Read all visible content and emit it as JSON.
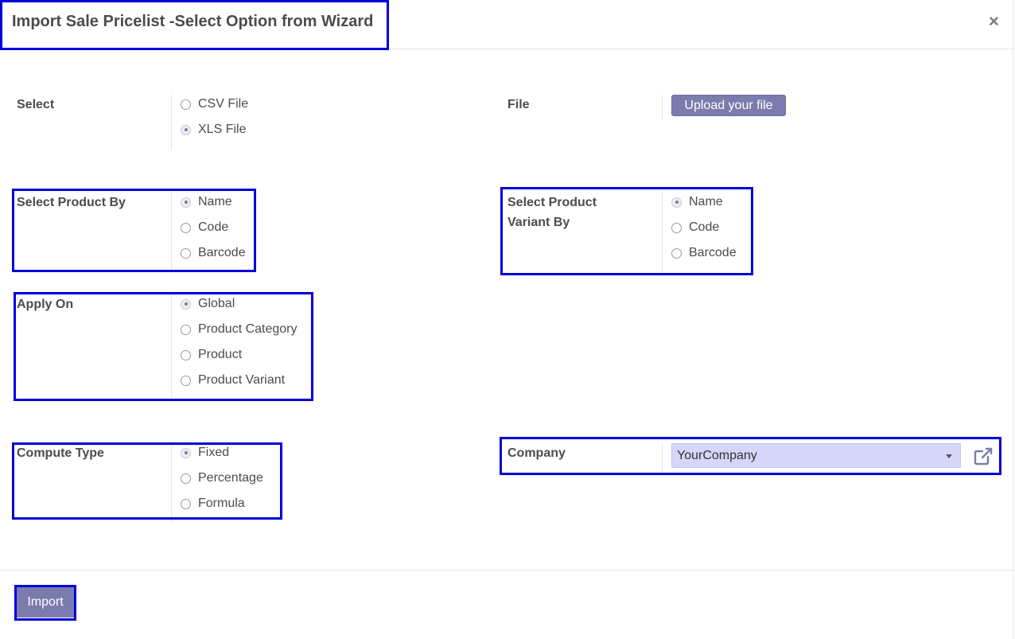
{
  "dialog": {
    "title": "Import Sale Pricelist -Select Option from Wizard",
    "close_label": "×"
  },
  "select": {
    "label": "Select",
    "options": [
      {
        "label": "CSV File",
        "checked": false
      },
      {
        "label": "XLS File",
        "checked": true
      }
    ]
  },
  "file": {
    "label": "File",
    "upload_label": "Upload your file"
  },
  "product_by": {
    "label": "Select Product By",
    "options": [
      {
        "label": "Name",
        "checked": true
      },
      {
        "label": "Code",
        "checked": false
      },
      {
        "label": "Barcode",
        "checked": false
      }
    ]
  },
  "variant_by": {
    "label_line1": "Select Product",
    "label_line2": "Variant By",
    "options": [
      {
        "label": "Name",
        "checked": true
      },
      {
        "label": "Code",
        "checked": false
      },
      {
        "label": "Barcode",
        "checked": false
      }
    ]
  },
  "apply_on": {
    "label": "Apply On",
    "options": [
      {
        "label": "Global",
        "checked": true
      },
      {
        "label": "Product Category",
        "checked": false
      },
      {
        "label": "Product",
        "checked": false
      },
      {
        "label": "Product Variant",
        "checked": false
      }
    ]
  },
  "compute_type": {
    "label": "Compute Type",
    "options": [
      {
        "label": "Fixed",
        "checked": true
      },
      {
        "label": "Percentage",
        "checked": false
      },
      {
        "label": "Formula",
        "checked": false
      }
    ]
  },
  "company": {
    "label": "Company",
    "value": "YourCompany"
  },
  "footer": {
    "import_label": "Import"
  },
  "colors": {
    "accent": "#7c7bad",
    "highlight": "#0000d9",
    "select_bg": "#d6d6fa"
  }
}
